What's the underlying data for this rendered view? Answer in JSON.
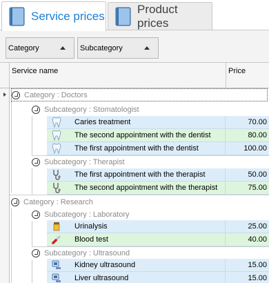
{
  "tabs": [
    {
      "label": "Service prices",
      "icon": "book-icon",
      "active": true
    },
    {
      "label": "Product prices",
      "icon": "book-icon",
      "active": false
    }
  ],
  "group_panel": {
    "category_label": "Category",
    "subcategory_label": "Subcategory"
  },
  "columns": {
    "name": "Service name",
    "price": "Price"
  },
  "groups": [
    {
      "category": "Category : Doctors",
      "subgroups": [
        {
          "subcategory": "Subcategory : Stomatologist",
          "rows": [
            {
              "name": "Caries treatment",
              "price": "70.00",
              "icon": "tooth-icon"
            },
            {
              "name": "The second appointment with the dentist",
              "price": "80.00",
              "icon": "tooth-icon"
            },
            {
              "name": "The first appointment with the dentist",
              "price": "100.00",
              "icon": "tooth-icon"
            }
          ]
        },
        {
          "subcategory": "Subcategory : Therapist",
          "rows": [
            {
              "name": "The first appointment with the therapist",
              "price": "50.00",
              "icon": "stethoscope-icon"
            },
            {
              "name": "The second appointment with the therapist",
              "price": "75.00",
              "icon": "stethoscope-icon"
            }
          ]
        }
      ]
    },
    {
      "category": "Category : Research",
      "subgroups": [
        {
          "subcategory": "Subcategory : Laboratory",
          "rows": [
            {
              "name": "Urinalysis",
              "price": "25.00",
              "icon": "urine-jar-icon"
            },
            {
              "name": "Blood test",
              "price": "40.00",
              "icon": "test-tube-icon"
            }
          ]
        },
        {
          "subcategory": "Subcategory : Ultrasound",
          "rows": [
            {
              "name": "Kidney ultrasound",
              "price": "15.00",
              "icon": "ultrasound-icon"
            },
            {
              "name": "Liver ultrasound",
              "price": "15.00",
              "icon": "ultrasound-icon"
            }
          ]
        }
      ]
    }
  ],
  "colors": {
    "accent": "#1a7fd4",
    "row_blue": "#dcedf9",
    "row_green": "#ddf5dd",
    "group_text": "#8a8a8a"
  }
}
